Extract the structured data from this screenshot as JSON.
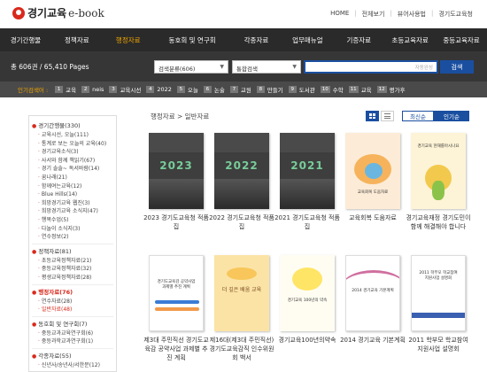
{
  "header": {
    "logo_title": "경기교육",
    "logo_sub": "e-book",
    "util_links": [
      "HOME",
      "전체보기",
      "뷰어사용법",
      "경기도교육청"
    ]
  },
  "nav": {
    "items": [
      "경기간행물",
      "정책자료",
      "행정자료",
      "동호회 및 연구회",
      "각종자료",
      "업무매뉴얼",
      "기증자료",
      "초등교육자료",
      "중등교육자료"
    ],
    "active_index": 2
  },
  "search": {
    "total_text": "총 606권 / 65,410 Pages",
    "category_value": "검색분류(606)",
    "type_value": "통합검색",
    "input_placeholder": "자동완성",
    "button_label": "검색"
  },
  "popular": {
    "label": "인기검색어 :",
    "items": [
      {
        "rank": "1",
        "word": "교육"
      },
      {
        "rank": "2",
        "word": "neis"
      },
      {
        "rank": "3",
        "word": "교육시선"
      },
      {
        "rank": "4",
        "word": "2022"
      },
      {
        "rank": "5",
        "word": "오늘"
      },
      {
        "rank": "6",
        "word": "논술"
      },
      {
        "rank": "7",
        "word": "교원"
      },
      {
        "rank": "8",
        "word": "만들기"
      },
      {
        "rank": "9",
        "word": "도서관"
      },
      {
        "rank": "10",
        "word": "수학"
      },
      {
        "rank": "11",
        "word": "교육"
      },
      {
        "rank": "12",
        "word": "평가후"
      }
    ]
  },
  "sidebar": {
    "c1": "경기간행물(330)",
    "c1_subs": [
      "교육시선, 오늘(111)",
      "통계로 보는 오늘의 교육(40)",
      "경기교육소식(3)",
      "사서와 함께 책읽기(67)",
      "경기 솔솔~ 독서바람(14)",
      "꿈나래(21)",
      "함께여는교육(12)",
      "Blue Hills(14)",
      "희망경기교육 웹진(3)",
      "희망경기교육 소식지(47)",
      "행복수업(5)",
      "다놀이 소식지(3)",
      "연수정보(2)"
    ],
    "c2": "정책자료(81)",
    "c2_subs": [
      "초등교육정책자료(21)",
      "중등교육정책자료(32)",
      "평생교육정책자료(28)"
    ],
    "c3": "행정자료(76)",
    "c3_subs": [
      "연수자료(28)",
      "일반자료(48)"
    ],
    "c3_active_sub": 1,
    "c4": "동호회 및 연구회(7)",
    "c4_subs": [
      "중등교과교육연구회(6)",
      "중등과학교과연구회(1)"
    ],
    "c5": "각종자료(55)",
    "c5_subs": [
      "신년사/송년사/서한문(12)"
    ]
  },
  "content": {
    "breadcrumb": "행정자료 > 일반자료",
    "sort_latest": "최신순",
    "sort_popular": "인기순",
    "books": [
      {
        "title": "2023 경기도교육청 적품집",
        "cover_text": "2023"
      },
      {
        "title": "2022 경기도교육청 적품집",
        "cover_text": "2022"
      },
      {
        "title": "2021 경기도교육청 적품집",
        "cover_text": "2021"
      },
      {
        "title": "교육회복 도움자료",
        "cover_text": "교육회복 도움자료"
      },
      {
        "title": "경기교육재정 경기도민이 함께 해결해야 합니다",
        "cover_text": "경기교육 현재를아시나요"
      },
      {
        "title": "제3대 주민직선 경기도교육감 공약사업 과제별 추진 계획",
        "cover_text": "경기도교육감 공약사업 과제별 추진 계획"
      },
      {
        "title": "제16대(제3대 주민직선) 경기도교육감직 인수위원회 백서",
        "cover_text": "더 깊은 배움 교육"
      },
      {
        "title": "경기교육100년의약속",
        "cover_text": "경기교육 100년의 약속"
      },
      {
        "title": "2014 경기교육 기본계획",
        "cover_text": "2014 경기교육 기본계획"
      },
      {
        "title": "2011 학부모 학교참여 지원사업 설명회",
        "cover_text": "2011 학부모 학교참여 지원사업 설명회"
      }
    ]
  }
}
